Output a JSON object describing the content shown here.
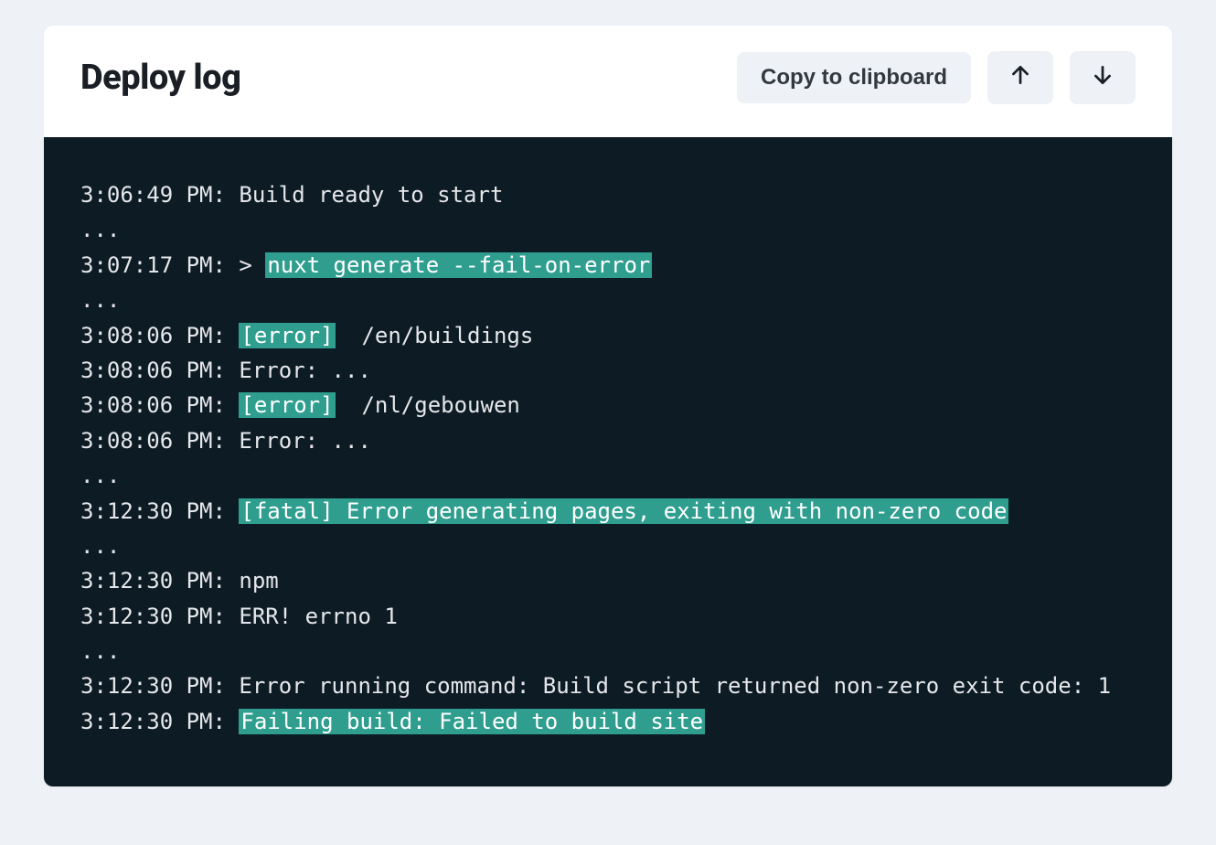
{
  "header": {
    "title": "Deploy log",
    "copy_label": "Copy to clipboard"
  },
  "log": {
    "lines": [
      {
        "timestamp": "3:06:49 PM:",
        "prefix": " ",
        "text": "Build ready to start",
        "highlight": false
      },
      {
        "timestamp": "",
        "prefix": "",
        "text": "...",
        "highlight": false
      },
      {
        "timestamp": "3:07:17 PM:",
        "prefix": " > ",
        "text": "nuxt generate --fail-on-error",
        "highlight": true
      },
      {
        "timestamp": "",
        "prefix": "",
        "text": "...",
        "highlight": false
      },
      {
        "timestamp": "3:08:06 PM:",
        "prefix": " ",
        "tag": "[error]",
        "text": "  /en/buildings",
        "highlight": false
      },
      {
        "timestamp": "3:08:06 PM:",
        "prefix": " ",
        "text": "Error: ...",
        "highlight": false
      },
      {
        "timestamp": "3:08:06 PM:",
        "prefix": " ",
        "tag": "[error]",
        "text": "  /nl/gebouwen",
        "highlight": false
      },
      {
        "timestamp": "3:08:06 PM:",
        "prefix": " ",
        "text": "Error: ...",
        "highlight": false
      },
      {
        "timestamp": "",
        "prefix": "",
        "text": "...",
        "highlight": false
      },
      {
        "timestamp": "3:12:30 PM:",
        "prefix": " ",
        "text": "[fatal] Error generating pages, exiting with non-zero code",
        "highlight": true
      },
      {
        "timestamp": "",
        "prefix": "",
        "text": "...",
        "highlight": false
      },
      {
        "timestamp": "3:12:30 PM:",
        "prefix": " ",
        "text": "npm",
        "highlight": false
      },
      {
        "timestamp": "3:12:30 PM:",
        "prefix": " ",
        "text": "ERR! errno 1",
        "highlight": false
      },
      {
        "timestamp": "",
        "prefix": "",
        "text": "...",
        "highlight": false
      },
      {
        "timestamp": "3:12:30 PM:",
        "prefix": " ",
        "text": "Error running command: Build script returned non-zero exit code: 1",
        "highlight": false
      },
      {
        "timestamp": "3:12:30 PM:",
        "prefix": " ",
        "text": "Failing build: Failed to build site",
        "highlight": true
      }
    ]
  }
}
